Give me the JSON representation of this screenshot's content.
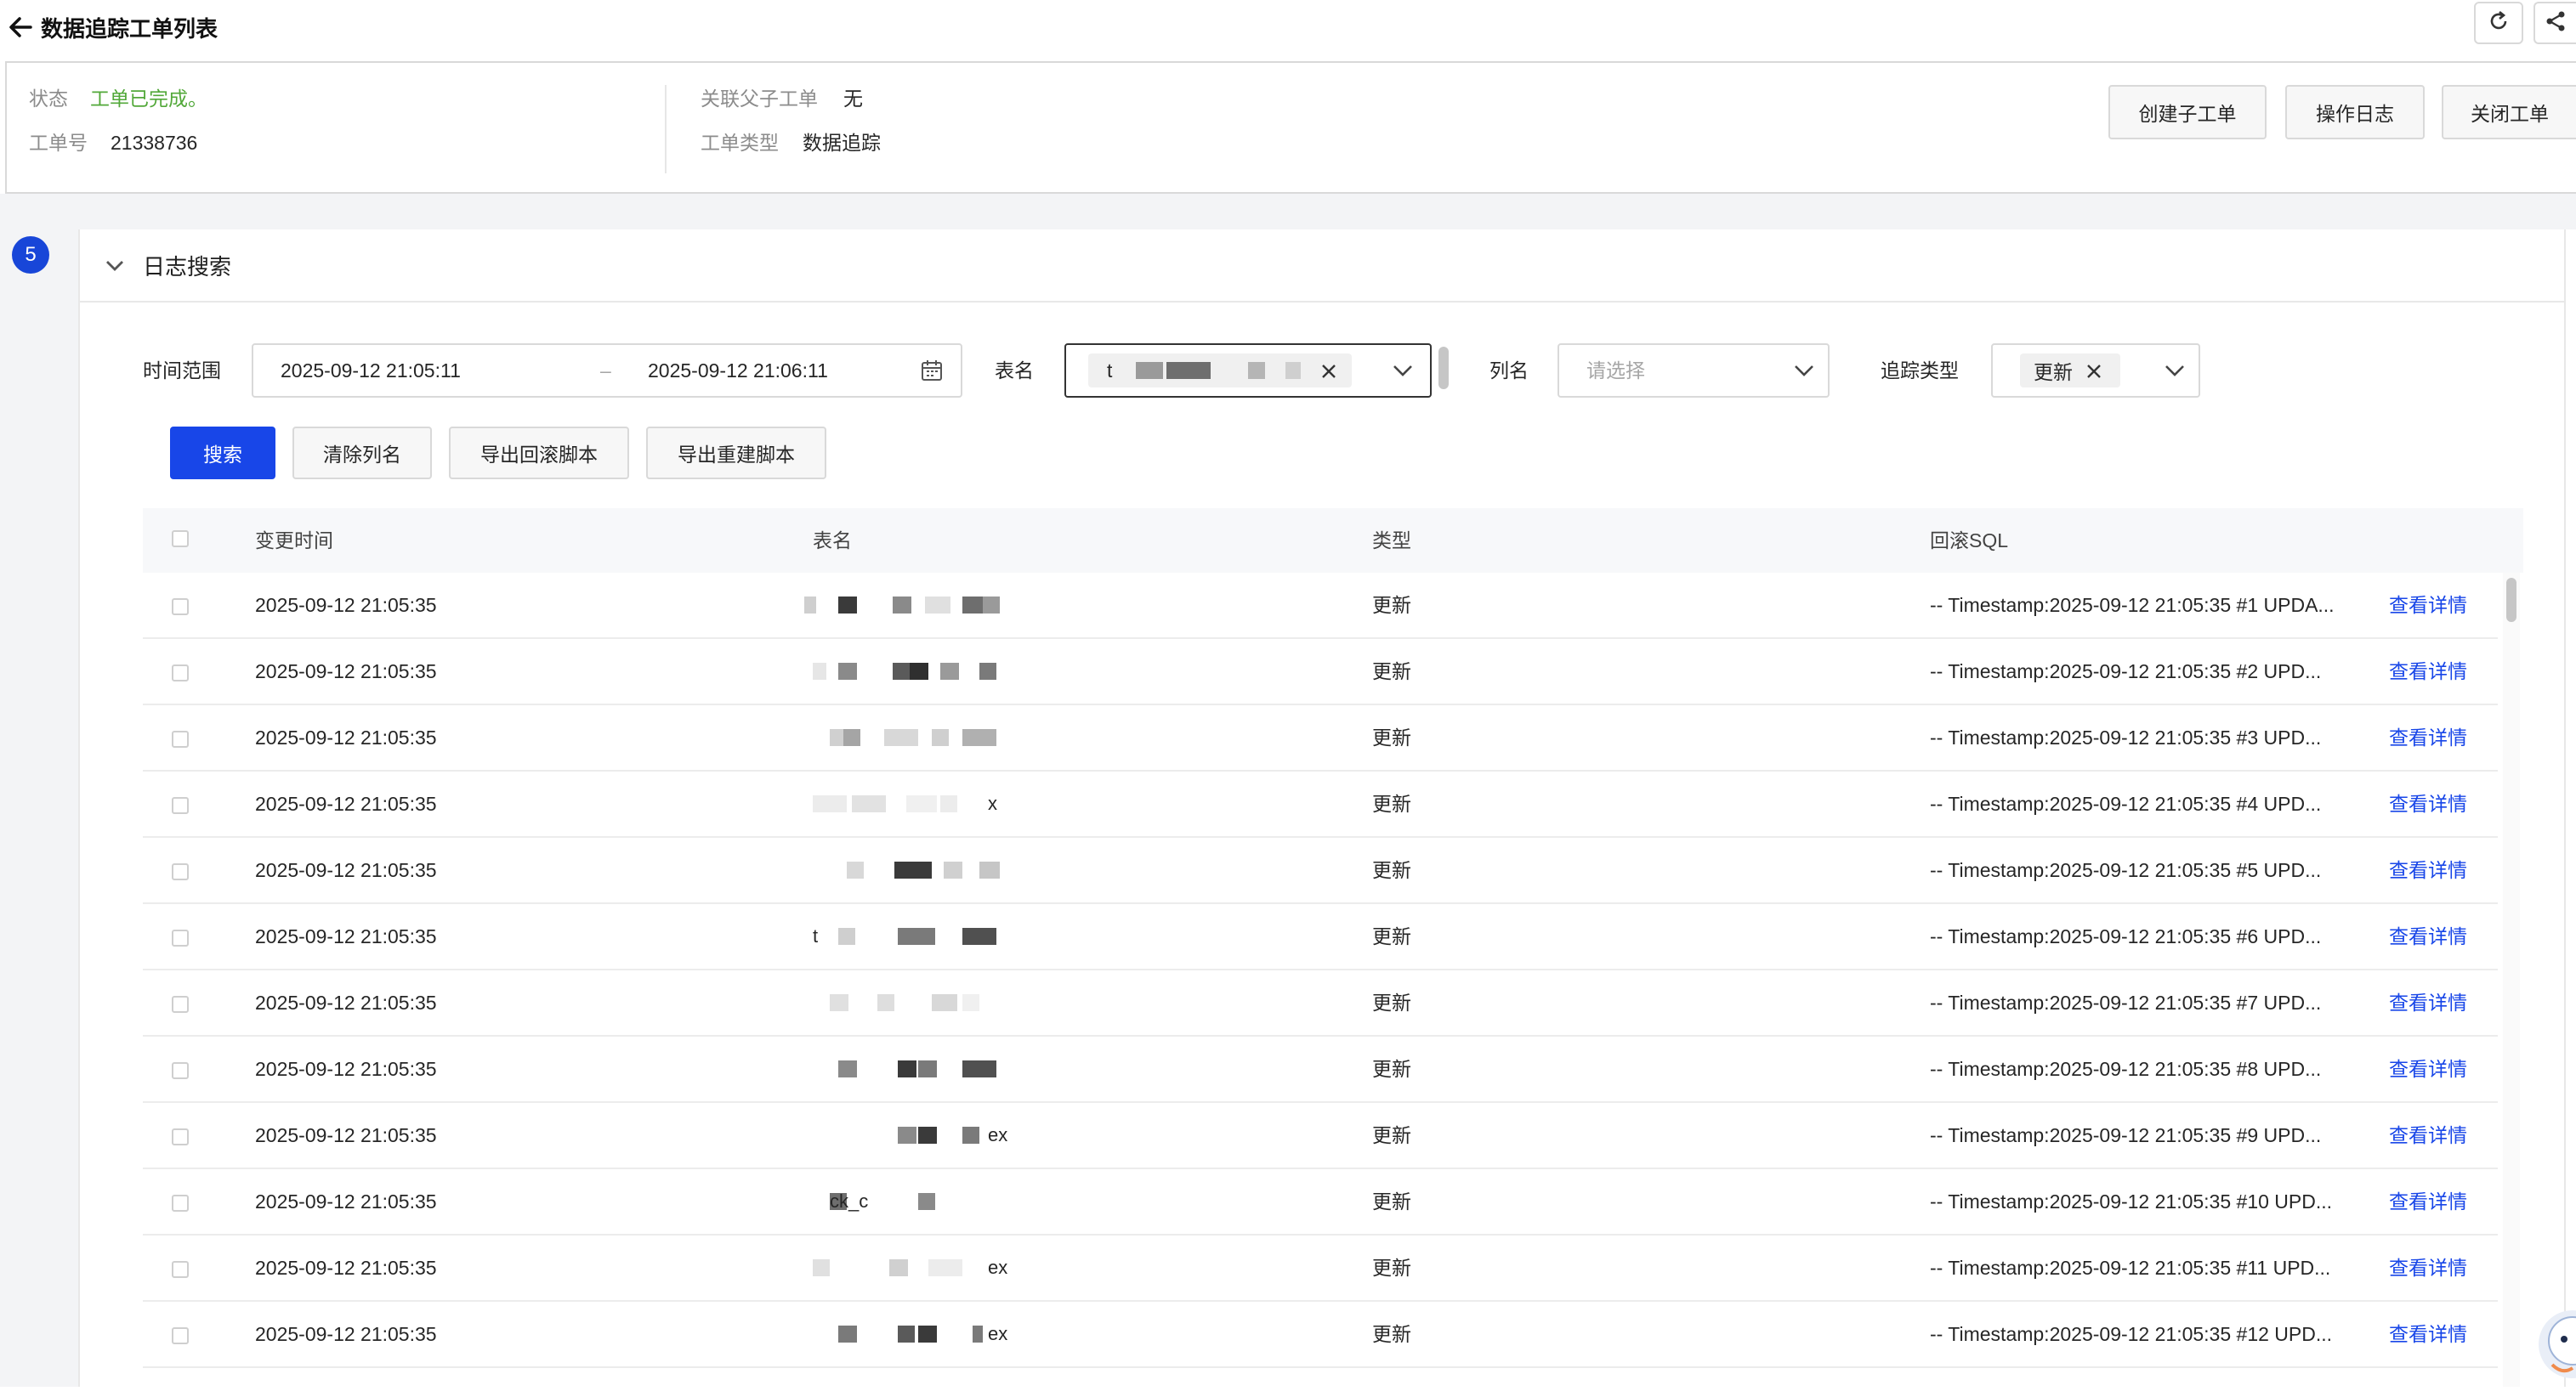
{
  "header": {
    "title": "数据追踪工单列表"
  },
  "info": {
    "status_label": "状态",
    "status_value": "工单已完成。",
    "ticket_no_label": "工单号",
    "ticket_no_value": "21338736",
    "related_label": "关联父子工单",
    "related_value": "无",
    "type_label": "工单类型",
    "type_value": "数据追踪",
    "actions": [
      "创建子工单",
      "操作日志",
      "关闭工单"
    ]
  },
  "step_badge": "5",
  "section": {
    "title": "日志搜索"
  },
  "filters": {
    "time_label": "时间范围",
    "time_start": "2025-09-12 21:05:11",
    "time_sep": "–",
    "time_end": "2025-09-12 21:06:11",
    "table_label": "表名",
    "table_value_prefix": "t",
    "column_label": "列名",
    "column_placeholder": "请选择",
    "trace_label": "追踪类型",
    "trace_tag": "更新"
  },
  "buttons": {
    "search": "搜索",
    "clear_columns": "清除列名",
    "export_rollback": "导出回滚脚本",
    "export_rebuild": "导出重建脚本"
  },
  "table": {
    "columns": [
      "变更时间",
      "表名",
      "类型",
      "回滚SQL"
    ],
    "detail_link": "查看详情",
    "rows": [
      {
        "time": "2025-09-12 21:05:35",
        "table": "",
        "type": "更新",
        "sql": "-- Timestamp:2025-09-12 21:05:35 #1 UPDA..."
      },
      {
        "time": "2025-09-12 21:05:35",
        "table": "",
        "type": "更新",
        "sql": "-- Timestamp:2025-09-12 21:05:35 #2 UPD..."
      },
      {
        "time": "2025-09-12 21:05:35",
        "table": "",
        "type": "更新",
        "sql": "-- Timestamp:2025-09-12 21:05:35 #3 UPD..."
      },
      {
        "time": "2025-09-12 21:05:35",
        "table": "x",
        "type": "更新",
        "sql": "-- Timestamp:2025-09-12 21:05:35 #4 UPD..."
      },
      {
        "time": "2025-09-12 21:05:35",
        "table": "",
        "type": "更新",
        "sql": "-- Timestamp:2025-09-12 21:05:35 #5 UPD..."
      },
      {
        "time": "2025-09-12 21:05:35",
        "table": "t",
        "type": "更新",
        "sql": "-- Timestamp:2025-09-12 21:05:35 #6 UPD..."
      },
      {
        "time": "2025-09-12 21:05:35",
        "table": "",
        "type": "更新",
        "sql": "-- Timestamp:2025-09-12 21:05:35 #7 UPD..."
      },
      {
        "time": "2025-09-12 21:05:35",
        "table": "",
        "type": "更新",
        "sql": "-- Timestamp:2025-09-12 21:05:35 #8 UPD..."
      },
      {
        "time": "2025-09-12 21:05:35",
        "table": "ex",
        "type": "更新",
        "sql": "-- Timestamp:2025-09-12 21:05:35 #9 UPD..."
      },
      {
        "time": "2025-09-12 21:05:35",
        "table": "ck_c",
        "type": "更新",
        "sql": "-- Timestamp:2025-09-12 21:05:35 #10 UPD..."
      },
      {
        "time": "2025-09-12 21:05:35",
        "table": "ex",
        "type": "更新",
        "sql": "-- Timestamp:2025-09-12 21:05:35 #11 UPD..."
      },
      {
        "time": "2025-09-12 21:05:35",
        "table": "ex",
        "type": "更新",
        "sql": "-- Timestamp:2025-09-12 21:05:35 #12 UPD..."
      }
    ]
  },
  "colors": {
    "primary": "#1846e8",
    "success": "#52a839",
    "border": "#d9d9d9",
    "header_bg": "#f7f8fa"
  },
  "icons": [
    "arrow-left-icon",
    "refresh-icon",
    "share-icon",
    "chevron-down-icon",
    "calendar-icon",
    "close-icon",
    "assistant-icon"
  ]
}
